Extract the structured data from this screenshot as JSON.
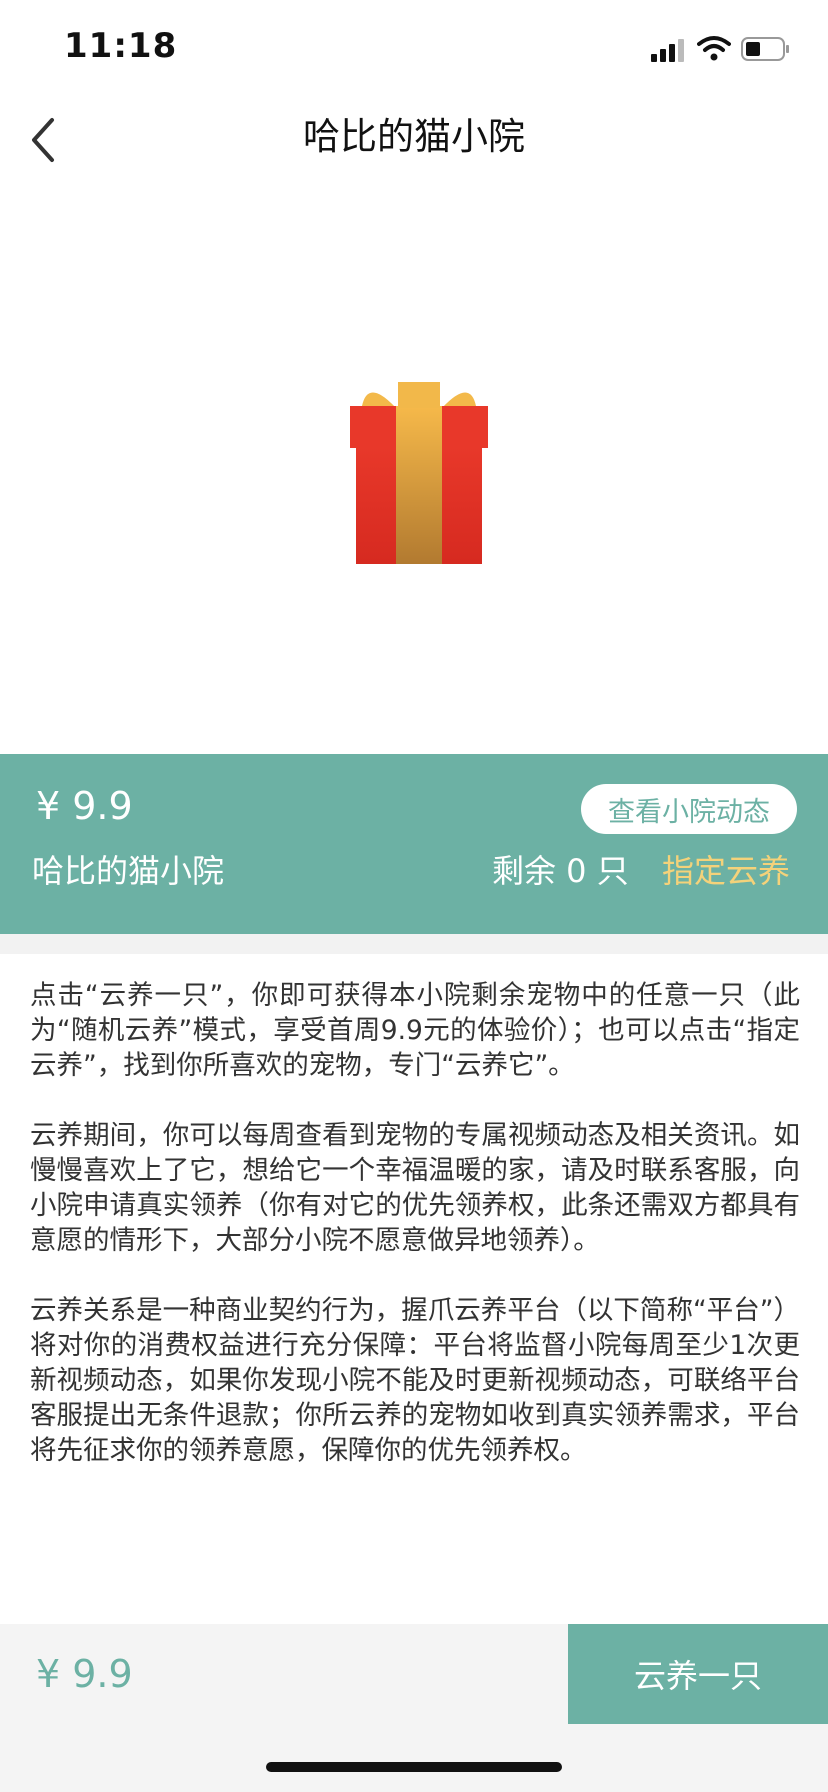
{
  "status_bar": {
    "time": "11:18"
  },
  "nav": {
    "title": "哈比的猫小院"
  },
  "info": {
    "price": "¥ 9.9",
    "yard_name": "哈比的猫小院",
    "view_button": "查看小院动态",
    "remaining": "剩余 0 只",
    "assign_link": "指定云养"
  },
  "description": [
    "点击“云养一只”，你即可获得本小院剩余宠物中的任意一只（此为“随机云养”模式，享受首周9.9元的体验价）；也可以点击“指定云养”，找到你所喜欢的宠物，专门“云养它”。",
    "云养期间，你可以每周查看到宠物的专属视频动态及相关资讯。如慢慢喜欢上了它，想给它一个幸福温暖的家，请及时联系客服，向小院申请真实领养（你有对它的优先领养权，此条还需双方都具有意愿的情形下，大部分小院不愿意做异地领养）。",
    "云养关系是一种商业契约行为，握爪云养平台（以下简称“平台”）将对你的消费权益进行充分保障：平台将监督小院每周至少1次更新视频动态，如果你发现小院不能及时更新视频动态，可联络平台客服提出无条件退款；你所云养的宠物如收到真实领养需求，平台将先征求你的领养意愿，保障你的优先领养权。"
  ],
  "bottom": {
    "price": "¥ 9.9",
    "adopt_button": "云养一只"
  },
  "colors": {
    "accent": "#6cb1a4",
    "highlight": "#f4d27a"
  },
  "icons": [
    "signal-icon",
    "wifi-icon",
    "battery-icon",
    "back-arrow-icon",
    "gift-icon"
  ]
}
